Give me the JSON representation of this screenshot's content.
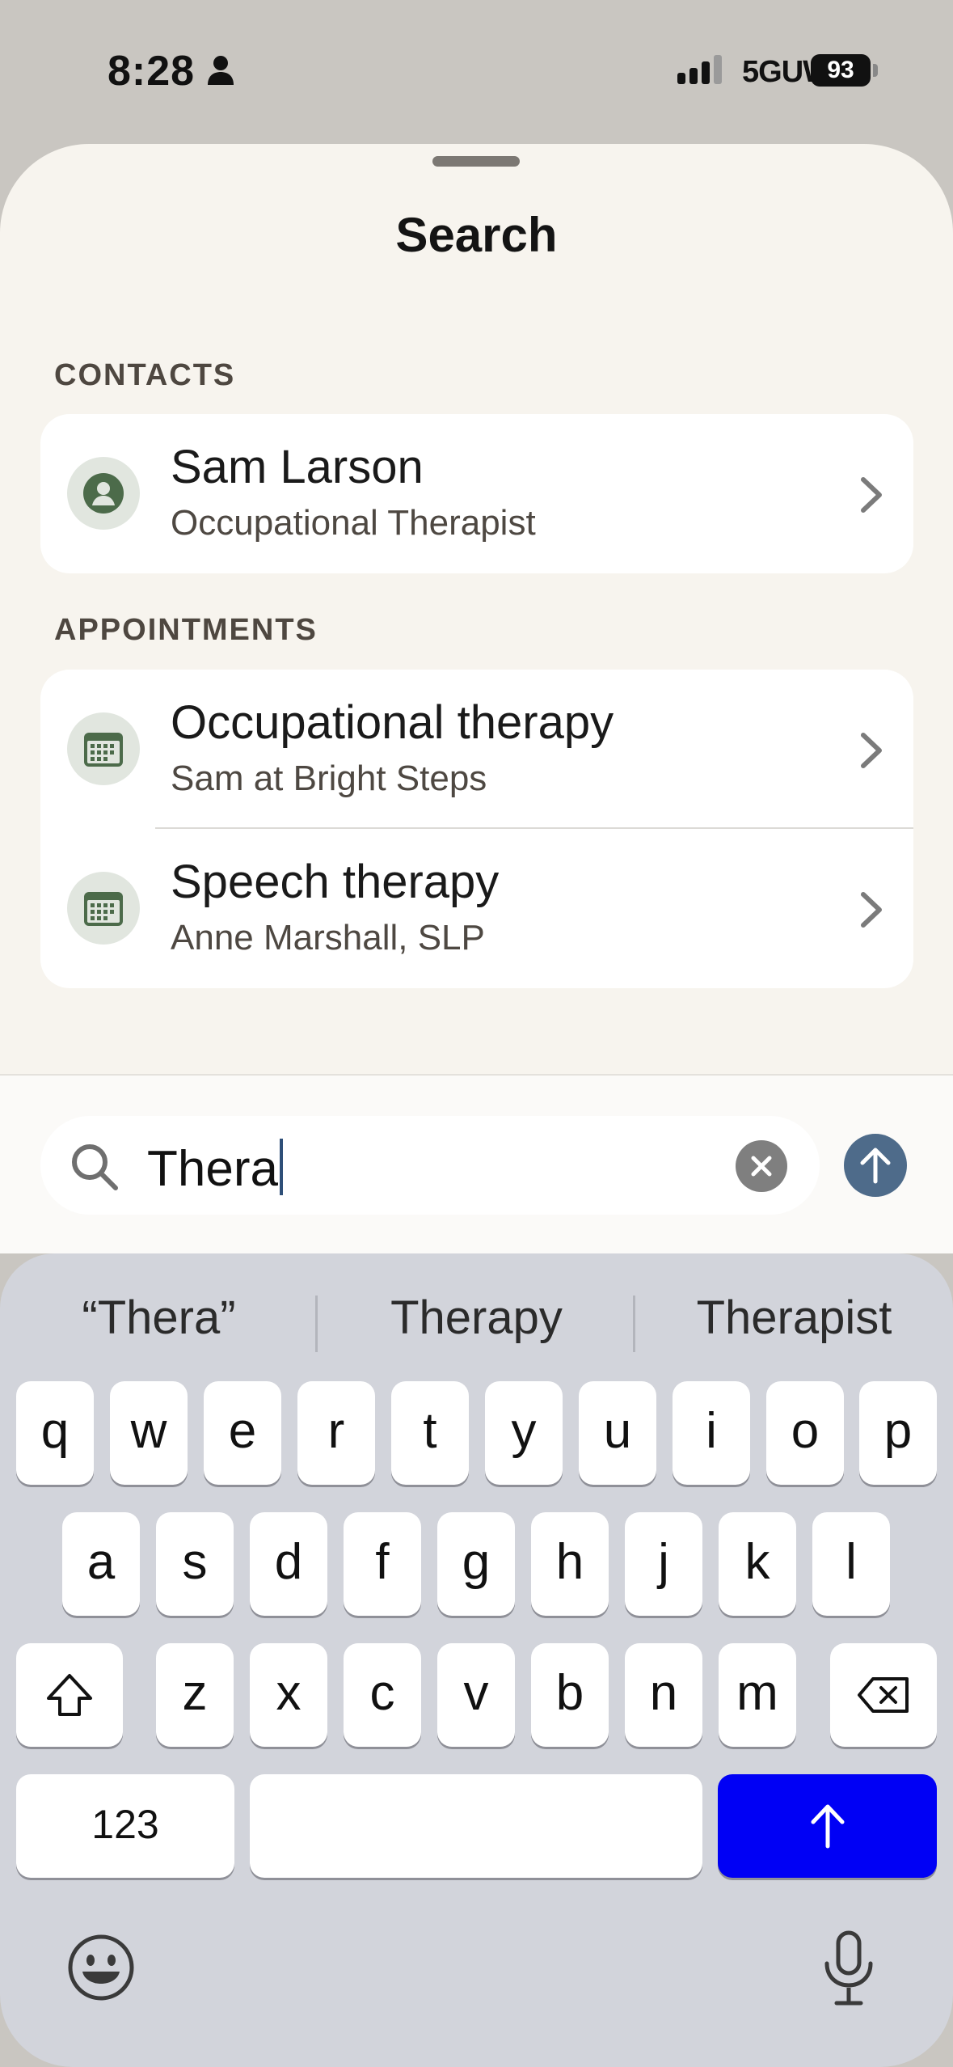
{
  "status_bar": {
    "time": "8:28",
    "network": "5GUW",
    "battery": "93"
  },
  "sheet": {
    "title": "Search",
    "sections": {
      "contacts": {
        "label": "CONTACTS",
        "items": [
          {
            "title": "Sam Larson",
            "subtitle": "Occupational Therapist",
            "icon": "person-circle-icon"
          }
        ]
      },
      "appointments": {
        "label": "APPOINTMENTS",
        "items": [
          {
            "title": "Occupational therapy",
            "subtitle": "Sam at Bright Steps",
            "icon": "calendar-icon"
          },
          {
            "title": "Speech therapy",
            "subtitle": "Anne Marshall, SLP",
            "icon": "calendar-icon"
          }
        ]
      }
    }
  },
  "search": {
    "value": "Thera",
    "icon": "magnifier-icon"
  },
  "keyboard": {
    "suggestions": [
      "“Thera”",
      "Therapy",
      "Therapist"
    ],
    "row1": [
      "q",
      "w",
      "e",
      "r",
      "t",
      "y",
      "u",
      "i",
      "o",
      "p"
    ],
    "row2": [
      "a",
      "s",
      "d",
      "f",
      "g",
      "h",
      "j",
      "k",
      "l"
    ],
    "row3": [
      "z",
      "x",
      "c",
      "v",
      "b",
      "n",
      "m"
    ],
    "numbers_label": "123"
  },
  "colors": {
    "accent_green": "#4c6b4a",
    "send_blue": "#4e6b8a",
    "return_blue": "#0000f5",
    "sheet_bg": "#f7f4ee"
  }
}
